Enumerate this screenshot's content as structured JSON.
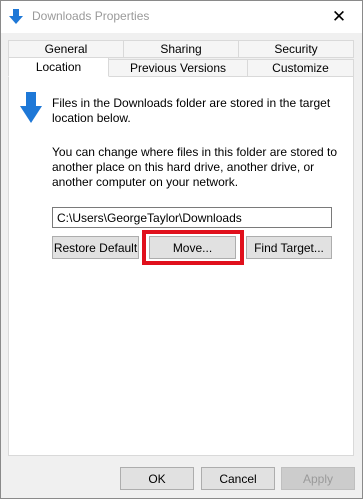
{
  "window": {
    "title": "Downloads Properties",
    "close_glyph": "✕"
  },
  "tabs": {
    "row1": [
      "General",
      "Sharing",
      "Security"
    ],
    "row2": [
      "Location",
      "Previous Versions",
      "Customize"
    ],
    "active": "Location"
  },
  "location": {
    "description1": "Files in the Downloads folder are stored in the target location below.",
    "description2": "You can change where files in this folder are stored to another place on this hard drive, another drive, or another computer on your network.",
    "path_value": "C:\\Users\\GeorgeTaylor\\Downloads",
    "restore_default_label": "Restore Default",
    "move_label": "Move...",
    "find_target_label": "Find Target..."
  },
  "footer": {
    "ok_label": "OK",
    "cancel_label": "Cancel",
    "apply_label": "Apply"
  },
  "colors": {
    "accent_icon": "#1e78d7",
    "highlight": "#e0101c"
  }
}
